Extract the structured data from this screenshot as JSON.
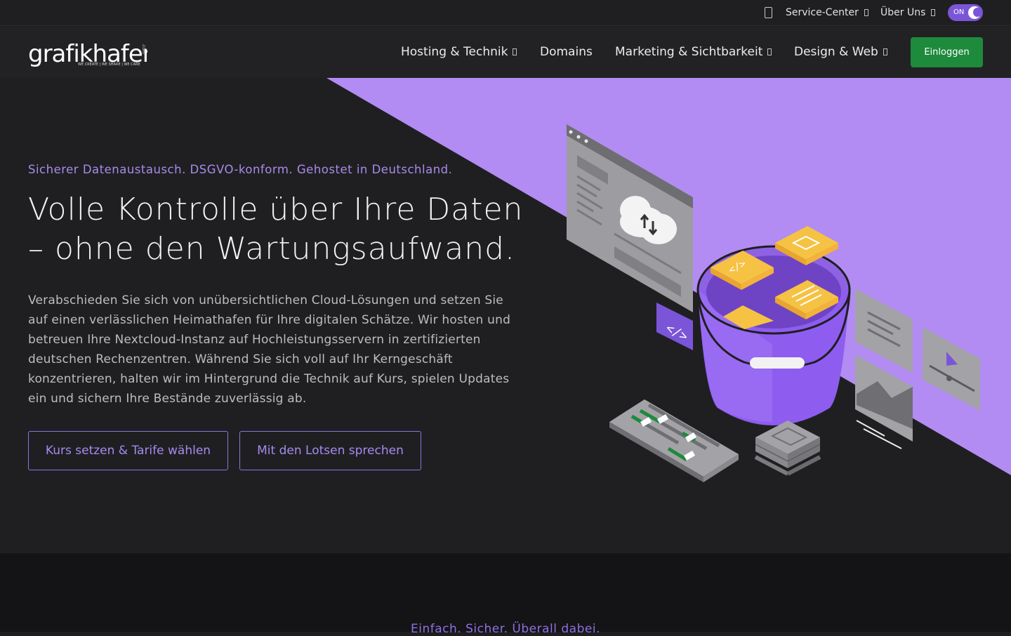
{
  "topbar": {
    "icon": "mobile-icon",
    "links": [
      {
        "label": "Service-Center"
      },
      {
        "label": "Über Uns"
      }
    ],
    "theme_toggle": {
      "label": "ON",
      "icon": "moon-icon"
    }
  },
  "nav": {
    "logo_word": "grafikhafen",
    "logo_suffix": ".com",
    "logo_tagline": "WE CREATE | WE SHARE | WE CARE",
    "items": [
      {
        "label": "Hosting & Technik",
        "has_dropdown": true
      },
      {
        "label": "Domains",
        "has_dropdown": false
      },
      {
        "label": "Marketing & Sichtbarkeit",
        "has_dropdown": true
      },
      {
        "label": "Design & Web",
        "has_dropdown": true
      }
    ],
    "login_label": "Einloggen"
  },
  "hero": {
    "kicker": "Sicherer Datenaustausch. DSGVO-konform. Gehostet in Deutschland.",
    "headline": "Volle Kontrolle über Ihre Daten – ohne den Wartungsaufwand.",
    "lead": "Verabschieden Sie sich von unübersichtlichen Cloud-Lösungen und setzen Sie auf einen verlässlichen Heimathafen für Ihre digitalen Schätze. Wir hosten und betreuen Ihre Nextcloud-Instanz auf Hochleistungsservern in zertifizierten deutschen Rechenzentren. Während Sie sich voll auf Ihr Kerngeschäft konzentrieren, halten wir im Hintergrund die Technik auf Kurs, spielen Updates ein und sichern Ihre Bestände zuverlässig ab.",
    "buttons": [
      {
        "label": "Kurs setzen & Tarife wählen"
      },
      {
        "label": "Mit den Lotsen sprechen"
      }
    ]
  },
  "section2": {
    "kicker": "Einfach. Sicher. Überall dabei."
  },
  "colors": {
    "accent": "#7b55d8",
    "accent_light": "#b28cf2",
    "login_green": "#1e8a3c",
    "background": "#1f1f21"
  }
}
